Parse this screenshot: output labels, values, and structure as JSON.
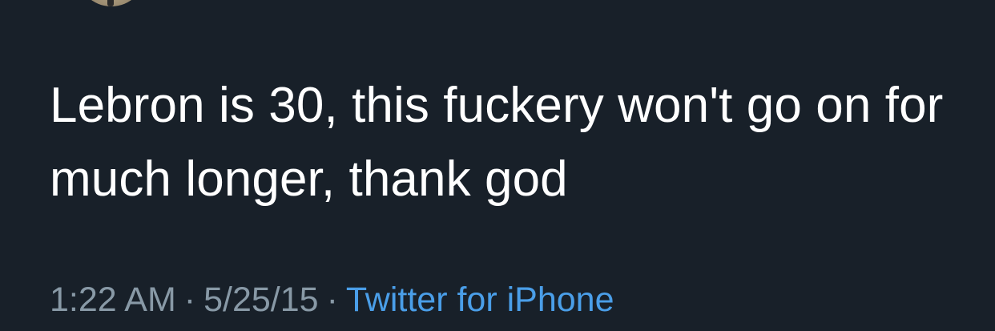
{
  "tweet": {
    "text": "Lebron is 30, this fuckery won't go on for much longer, thank god",
    "time": "1:22 AM",
    "date": "5/25/15",
    "source": "Twitter for iPhone",
    "separator": "·"
  },
  "colors": {
    "background": "#182029",
    "text": "#ffffff",
    "meta": "#8899a6",
    "link": "#4a9ee8"
  }
}
